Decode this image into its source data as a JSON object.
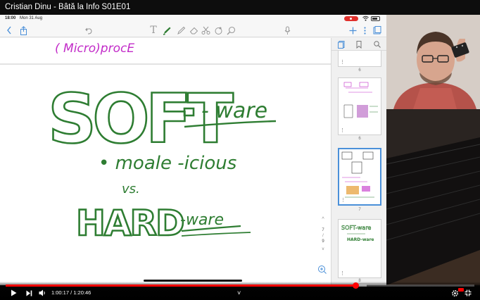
{
  "window": {
    "title": "Cristian Dinu - Bâtă la Info S01E01"
  },
  "ipad": {
    "status": {
      "time": "18:00",
      "date": "Mon 31 Aug"
    },
    "toolbar": {
      "icons": [
        "chevron-left-icon",
        "share-icon",
        "undo-icon",
        "text-tool-icon",
        "pen-tool-icon",
        "highlighter-icon",
        "eraser-icon",
        "lasso-icon",
        "shapes-icon",
        "zoom-tool-icon",
        "microphone-icon",
        "add-icon",
        "more-icon",
        "bookmark-page-icon"
      ]
    },
    "sidebar": {
      "thumbnails": [
        {
          "number": "6",
          "selected": false
        },
        {
          "number": "6",
          "selected": false
        },
        {
          "number": "7",
          "selected": true
        },
        {
          "number": "8",
          "selected": false
        }
      ],
      "thumb_title_8": "SOFT-ware",
      "thumb_hard_8": "HARD-ware"
    },
    "pager": {
      "up": "^",
      "current": "7",
      "sep": "/",
      "total": "9",
      "down": "v"
    }
  },
  "handwriting": {
    "heading_partial": "( Micro)procE",
    "soft": "SOFT",
    "soft_suffix": "- ware",
    "bullet": "• moale -icious",
    "vs": "vs.",
    "hard": "HARD",
    "hard_suffix": "-ware"
  },
  "colors": {
    "ink_green": "#2e7d32",
    "ink_magenta": "#c22bc8",
    "yt_red": "#ff0000"
  },
  "player": {
    "current_time": "1:00:17",
    "duration": "1:20:46",
    "time_display": "1:00:17 / 1:20:46",
    "played_fraction": 0.7463,
    "loaded_fraction": 0.77,
    "chevron": "˅"
  }
}
